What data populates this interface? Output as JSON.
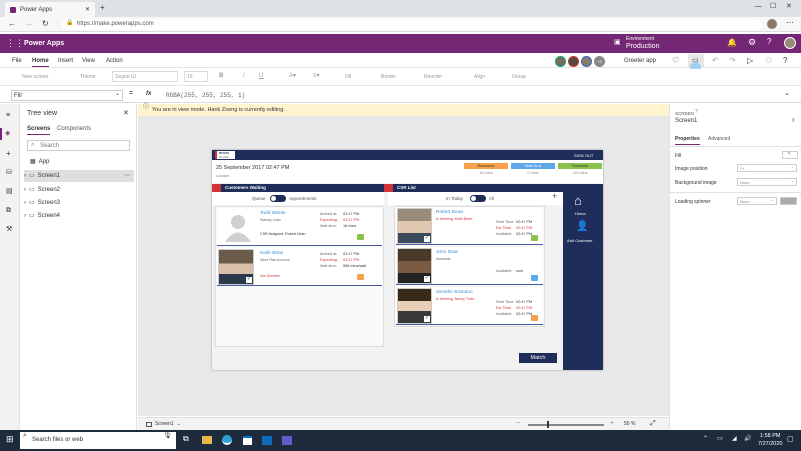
{
  "browser": {
    "tab_title": "Power Apps",
    "url": "https://make.powerapps.com"
  },
  "header": {
    "app_name": "Power Apps",
    "env_label": "Environment",
    "env_name": "Production"
  },
  "menu": {
    "items": [
      "File",
      "Home",
      "Insert",
      "View",
      "Action"
    ],
    "active": "Home"
  },
  "toolbar": {
    "new_screen": "New screen",
    "theme": "Theme",
    "font": "Segoe UI",
    "font_size": "15",
    "bold": "B",
    "italic": "/",
    "underline": "U",
    "fill": "Fill",
    "border": "Border",
    "reorder": "Reorder",
    "align": "Align",
    "group": "Group",
    "app_name_btn": "Greeter app"
  },
  "formula": {
    "property": "Fill",
    "fx": "fx",
    "value": "RGBA(255, 255, 255, 1)"
  },
  "banner": {
    "text": "You are in view mode. Hank Zoeng is currently editing."
  },
  "tree": {
    "title": "Tree view",
    "tab_screens": "Screens",
    "tab_components": "Components",
    "search": "Search",
    "app": "App",
    "screens": [
      "Screen1",
      "Screen2",
      "Screen3",
      "Screen4"
    ]
  },
  "props": {
    "section": "SCREEN",
    "name": "Screen1",
    "tab_properties": "Properties",
    "tab_advanced": "Advanced",
    "rows": [
      {
        "label": "Fill",
        "value": ""
      },
      {
        "label": "Image position",
        "value": "Fit"
      },
      {
        "label": "Background image",
        "value": "None"
      },
      {
        "label": "Loading spinner",
        "value": "None"
      }
    ]
  },
  "status": {
    "screen": "Screen1",
    "zoom": "50 %"
  },
  "taskbar": {
    "search": "Search files or web",
    "time": "1:58 PM",
    "date": "7/27/2020"
  },
  "app": {
    "logo_line1": "RFUSS",
    "logo_line2": "bruskal",
    "sign_out": "SIGN OUT",
    "date": "25 September 2017 02:47 PM",
    "location": "London",
    "stats": [
      {
        "label": "Resource",
        "value": "16 mins",
        "color": "#f7a24a"
      },
      {
        "label": "Wait SLA",
        "value": "0 mins",
        "color": "#5ea7e8"
      },
      {
        "label": "Summed",
        "value": "119 mins",
        "color": "#8bc34a"
      }
    ],
    "customers_title": "Customers Waiting",
    "csr_title": "CSR List",
    "queue": "Queue",
    "appointments": "Appointments",
    "in_today": "In Today",
    "all": "All",
    "customers": [
      {
        "name": "Todd Warde",
        "sub": "Startup Loan",
        "note": "CSR Assigned: Robert Dean",
        "arrived_label": "Arrived at:",
        "arrived": "02:47 PM",
        "expecting_label": "Expecting:",
        "expecting": "02:47 PM",
        "wait_label": "Wait time:",
        "wait": "16 mins",
        "chip": "#8bc34a"
      },
      {
        "name": "Keith Brian",
        "sub": "Save Plan Amount",
        "note": "Not Greeted",
        "arrived_label": "Arrived at:",
        "arrived": "02:47 PM",
        "expecting_label": "Expecting:",
        "expecting": "02:47 PM",
        "wait_label": "Wait time:",
        "wait": "566 mins/wait",
        "chip": "#f7a24a"
      }
    ],
    "csrs": [
      {
        "name": "Robert Dean",
        "status": "In Meeting: Keith Brian",
        "start_label": "Start Time:",
        "start": "02:47 PM",
        "end_label": "Est Time:",
        "end": "02:47 PM",
        "avail_label": "Available:",
        "avail": "02:47 PM",
        "chip": "#8bc34a"
      },
      {
        "name": "John Deal",
        "status": "Available",
        "start_label": "",
        "start": "",
        "end_label": "",
        "end": "",
        "avail_label": "Available:",
        "avail": "now",
        "chip": "#5ea7e8"
      },
      {
        "name": "Jennifer Brandon",
        "status": "In Meeting: Nancy Todd",
        "start_label": "Start Time:",
        "start": "02:47 PM",
        "end_label": "Est Time:",
        "end": "02:47 PM",
        "avail_label": "Available:",
        "avail": "02:47 PM",
        "chip": "#f7a24a"
      }
    ],
    "nav_home": "Home",
    "nav_add": "Add Customer",
    "match": "Match"
  }
}
